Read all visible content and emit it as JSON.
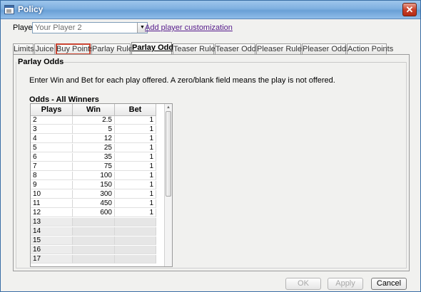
{
  "window": {
    "title": "Policy",
    "close_glyph": "✕"
  },
  "player": {
    "label": "Player",
    "selected": "Your Player 2",
    "customize_link": "Add player customization"
  },
  "tabs": [
    {
      "label": "Limits",
      "state": "normal"
    },
    {
      "label": "Juice",
      "state": "normal"
    },
    {
      "label": "Buy Points",
      "state": "hover"
    },
    {
      "label": "Parlay Rules",
      "state": "normal"
    },
    {
      "label": "Parlay Odds",
      "state": "active"
    },
    {
      "label": "Teaser Rules",
      "state": "normal"
    },
    {
      "label": "Teaser Odds",
      "state": "normal"
    },
    {
      "label": "Pleaser Rules",
      "state": "normal"
    },
    {
      "label": "Pleaser Odds",
      "state": "normal"
    },
    {
      "label": "Action Points",
      "state": "normal"
    }
  ],
  "panel": {
    "group_title": "Parlay Odds",
    "instructions": "Enter Win and Bet for each play offered.  A zero/blank field means the play is not offered.",
    "grid_title": "Odds - All Winners"
  },
  "grid": {
    "headers": [
      "Plays",
      "Win",
      "Bet"
    ],
    "rows": [
      [
        "2",
        "2.5",
        "1"
      ],
      [
        "3",
        "5",
        "1"
      ],
      [
        "4",
        "12",
        "1"
      ],
      [
        "5",
        "25",
        "1"
      ],
      [
        "6",
        "35",
        "1"
      ],
      [
        "7",
        "75",
        "1"
      ],
      [
        "8",
        "100",
        "1"
      ],
      [
        "9",
        "150",
        "1"
      ],
      [
        "10",
        "300",
        "1"
      ],
      [
        "11",
        "450",
        "1"
      ],
      [
        "12",
        "600",
        "1"
      ],
      [
        "13",
        "",
        ""
      ],
      [
        "14",
        "",
        ""
      ],
      [
        "15",
        "",
        ""
      ],
      [
        "16",
        "",
        ""
      ],
      [
        "17",
        "",
        ""
      ]
    ]
  },
  "buttons": {
    "ok": "OK",
    "apply": "Apply",
    "cancel": "Cancel"
  },
  "icons": {
    "dropdown": "▼",
    "scroll_up": "▲"
  }
}
